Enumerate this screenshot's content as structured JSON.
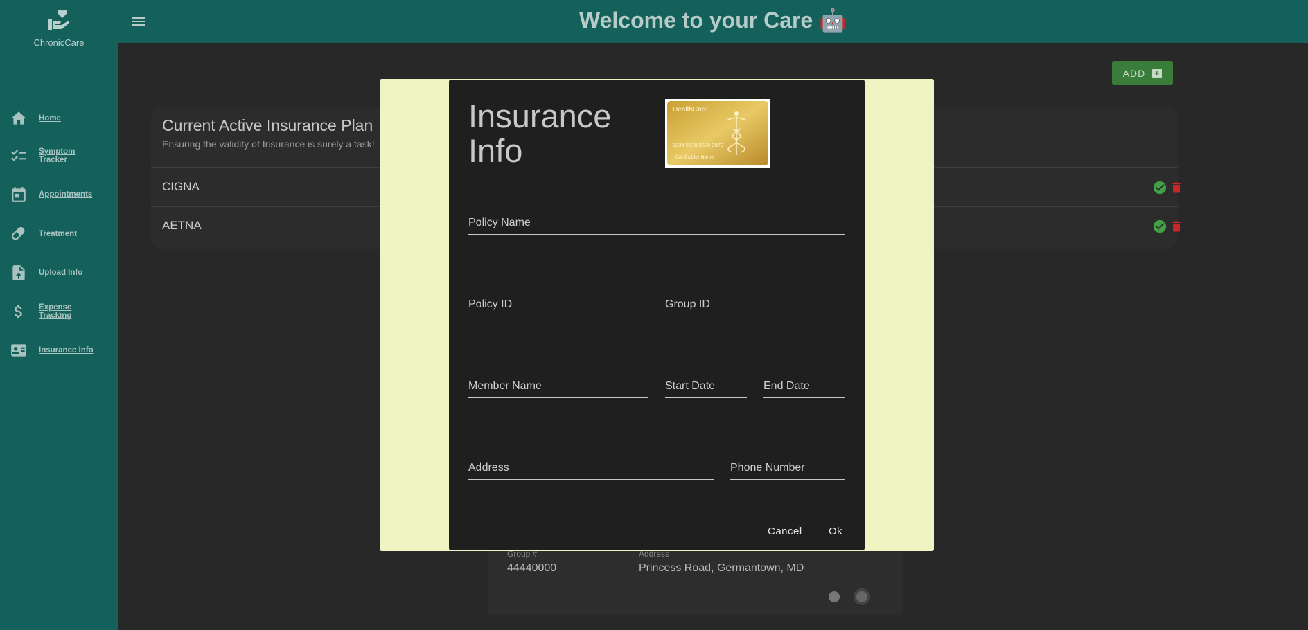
{
  "app": {
    "name": "ChronicCare"
  },
  "header": {
    "title": "Welcome to your Care 🤖"
  },
  "sidebar": {
    "items": [
      {
        "label": "Home",
        "icon": "home-icon"
      },
      {
        "label": "Symptom Tracker",
        "icon": "checklist-icon"
      },
      {
        "label": "Appointments",
        "icon": "calendar-icon"
      },
      {
        "label": "Treatment",
        "icon": "pill-icon"
      },
      {
        "label": "Upload Info",
        "icon": "upload-file-icon"
      },
      {
        "label": "Expense Tracking",
        "icon": "dollar-icon"
      },
      {
        "label": "Insurance Info",
        "icon": "id-card-icon"
      }
    ]
  },
  "toolbar": {
    "add_label": "ADD"
  },
  "plans_card": {
    "title": "Current Active Insurance Plan",
    "subtitle": "Ensuring the validity of Insurance is surely a task!",
    "plans": [
      "CIGNA",
      "AETNA"
    ]
  },
  "background_form": {
    "group_label": "Group #",
    "group_value": "44440000",
    "address_label": "Address",
    "address_value": "Princess Road, Germantown, MD"
  },
  "dialog": {
    "title": "Insurance Info",
    "card_image": {
      "brand": "HealthCard",
      "number": "1234 5678 5678 9870",
      "holder": "Cardholder Name"
    },
    "fields": {
      "policy_name": "Policy Name",
      "policy_id": "Policy ID",
      "group_id": "Group ID",
      "member_name": "Member Name",
      "start_date": "Start Date",
      "end_date": "End Date",
      "address": "Address",
      "phone_number": "Phone Number"
    },
    "cancel_label": "Cancel",
    "ok_label": "Ok"
  },
  "colors": {
    "sidebar": "#14605a",
    "backdrop": "#f0f4c3",
    "dialog": "#1f1f1f",
    "add_button": "#3a7d3a",
    "check": "#43a047",
    "delete": "#c62828"
  }
}
